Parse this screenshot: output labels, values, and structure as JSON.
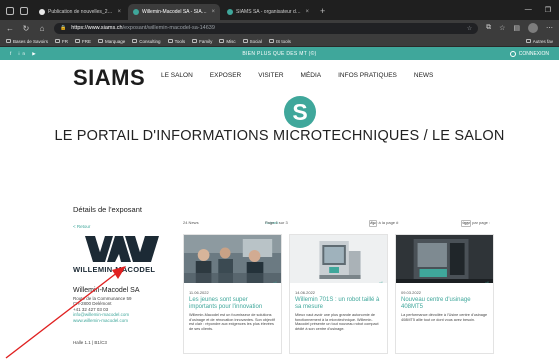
{
  "browser": {
    "tabs": [
      {
        "title": "Publication de nouvelles_24.pdf",
        "active": false,
        "favicon_color": "#e8e8e8"
      },
      {
        "title": "Willemin-Macodel SA - SIAMS",
        "active": true,
        "favicon_color": "#3fa79b"
      },
      {
        "title": "SIAMS SA - organisateur de salo",
        "active": false,
        "favicon_color": "#3fa79b"
      }
    ],
    "new_tab_symbol": "+",
    "close_symbol": "×",
    "address": {
      "host": "https://www.siams.ch",
      "path": "/exposant/willemin-macodel-sa-14639"
    },
    "bookmarks": [
      "Bases de Savoirs",
      "FR",
      "FRE",
      "Marquage",
      "Consulting",
      "Tools",
      "Family",
      "Misc",
      "Social",
      "IS tools"
    ],
    "bookmarks_right": "Autres fav"
  },
  "site": {
    "promo": "BIEN PLUS QUE DES MT (©)",
    "social": "f  in  ▶",
    "login": "CONNEXION",
    "logo": "SIAMS",
    "menu": [
      "LE SALON",
      "EXPOSER",
      "VISITER",
      "MÉDIA",
      "INFOS PRATIQUES",
      "NEWS"
    ],
    "badge": "S",
    "title": "LE PORTAIL D'INFORMATIONS MICROTECHNIQUES / LE SALON"
  },
  "exhibitor": {
    "section_title": "Détails de l'exposant",
    "back": "< Retour",
    "logo_text": "WILLEMIN-MACODEL",
    "name": "Willemin-Macodel SA",
    "address_lines": [
      "Route de la Communance 59",
      "CH-2800 Delémont",
      "+41 32 427 03 03"
    ],
    "email": "info@willemin-macodel.com",
    "website": "www.willemin-macodel.com",
    "hall": "Halle 1.1 | B1/C3"
  },
  "list": {
    "count": "24 News",
    "page": "Page 1 sur 3",
    "next": "Suivant",
    "sort_label": "Mise à la page #",
    "sort_value": "1",
    "per_page_label": "News par page :",
    "per_page_value": "10"
  },
  "cards": [
    {
      "date": "11.06.2022",
      "title": "Les jeunes sont super importants pour l'innovation",
      "body": "Willemin-Macodel est un fournisseur de solutions d'usinage et de rénovation innovantes. Son objectif est clair : répondre aux exigences les plus élevées de ses clients."
    },
    {
      "date": "14.06.2022",
      "title": "Willemin 701S : un robot taillé à sa mesure",
      "body": "Mieux vaut avoir une plus grande autonomie de fonctionnement à la microtechnique. Willemin-Macodel présente un tout nouveau robot compact dédié à son centre d'usinage."
    },
    {
      "date": "09.03.2022",
      "title": "Nouveau centre d'usinage 408MT5",
      "body": "La performance dévoilée à l'Usine centre d'usinage 408MT5 allie tout ce dont vous avez besoin."
    }
  ],
  "colors": {
    "accent": "#3fa79b",
    "chrome_dark": "#1f1f1f",
    "chrome": "#3c3c3c",
    "pointer": "#e02020"
  }
}
